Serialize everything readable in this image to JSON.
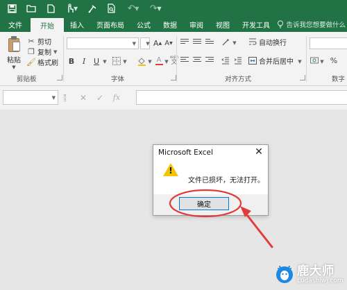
{
  "colors": {
    "brand": "#217346",
    "ribbon_bg": "#f3f3f3",
    "annotation": "#e23b3b",
    "warning": "#f5c400",
    "focus": "#0078d7"
  },
  "quick_access": {
    "icons": [
      "save-icon",
      "open-folder-icon",
      "new-file-icon",
      "touch-mode-icon",
      "format-painter-icon",
      "print-preview-icon",
      "undo-icon",
      "redo-icon"
    ]
  },
  "tabs": {
    "file": "文件",
    "home": "开始",
    "insert": "插入",
    "page_layout": "页面布局",
    "formulas": "公式",
    "data": "数据",
    "review": "审阅",
    "view": "视图",
    "developer": "开发工具",
    "tell_me": "告诉我您想要做什么"
  },
  "ribbon": {
    "clipboard": {
      "paste": "粘贴",
      "cut": "剪切",
      "copy": "复制",
      "format_painter": "格式刷",
      "group_label": "剪贴板"
    },
    "font": {
      "group_label": "字体",
      "font_name": "",
      "font_size": "",
      "grow": "A",
      "shrink": "A",
      "bold": "B",
      "italic": "I",
      "underline": "U",
      "font_color": "A",
      "wen": "wén"
    },
    "alignment": {
      "group_label": "对齐方式",
      "wrap_text": "自动换行",
      "merge_center": "合并后居中"
    },
    "number": {
      "group_label": "数字"
    }
  },
  "formula_bar": {
    "name_box": "",
    "cancel": "✕",
    "enter": "✓",
    "fx": "fx",
    "value": ""
  },
  "dialog": {
    "title": "Microsoft Excel",
    "close": "✕",
    "message": "文件已损坏，无法打开。",
    "ok": "确定",
    "icon": "warning-icon"
  },
  "watermark": {
    "name": "鹿大师",
    "url": "Ludashiwj.com"
  }
}
